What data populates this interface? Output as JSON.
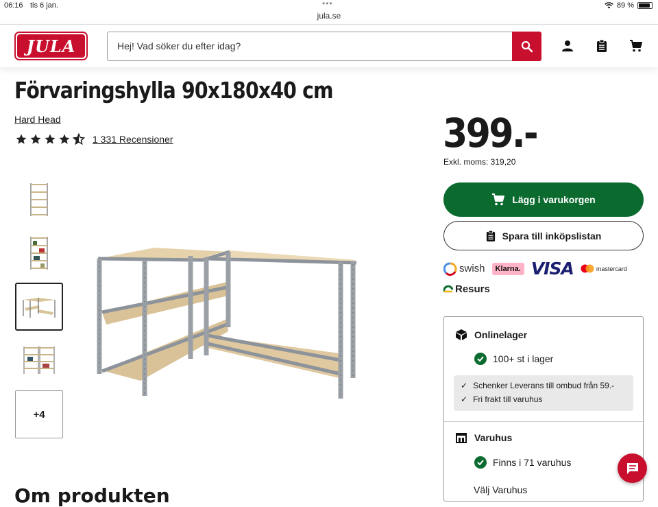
{
  "status_bar": {
    "time": "06:16",
    "date": "tis 6 jan.",
    "dots": "•••",
    "url": "jula.se",
    "battery": "89 %"
  },
  "header": {
    "logo_text": "JULA",
    "search_placeholder": "Hej! Vad söker du efter idag?"
  },
  "product": {
    "title": "Förvaringshylla 90x180x40 cm",
    "brand": "Hard Head",
    "rating": 4.5,
    "reviews": "1 331 Recensioner",
    "more_images": "+4",
    "about_heading": "Om produkten"
  },
  "buy": {
    "price": "399.-",
    "vat": "Exkl. moms: 319,20",
    "cart_label": "Lägg i varukorgen",
    "list_label": "Spara till inköpslistan",
    "payments": {
      "swish": "swish",
      "klarna": "Klarna.",
      "visa": "VISA",
      "mastercard": "mastercard",
      "resurs": "Resurs"
    }
  },
  "stock": {
    "online_title": "Onlinelager",
    "online_status": "100+ st i lager",
    "delivery": [
      "Schenker Leverans till ombud från 59.-",
      "Fri frakt till varuhus"
    ],
    "store_title": "Varuhus",
    "store_status": "Finns i 71 varuhus",
    "choose_store": "Välj Varuhus"
  },
  "colors": {
    "brand_red": "#c8102e",
    "cta_green": "#0b6b2f"
  }
}
